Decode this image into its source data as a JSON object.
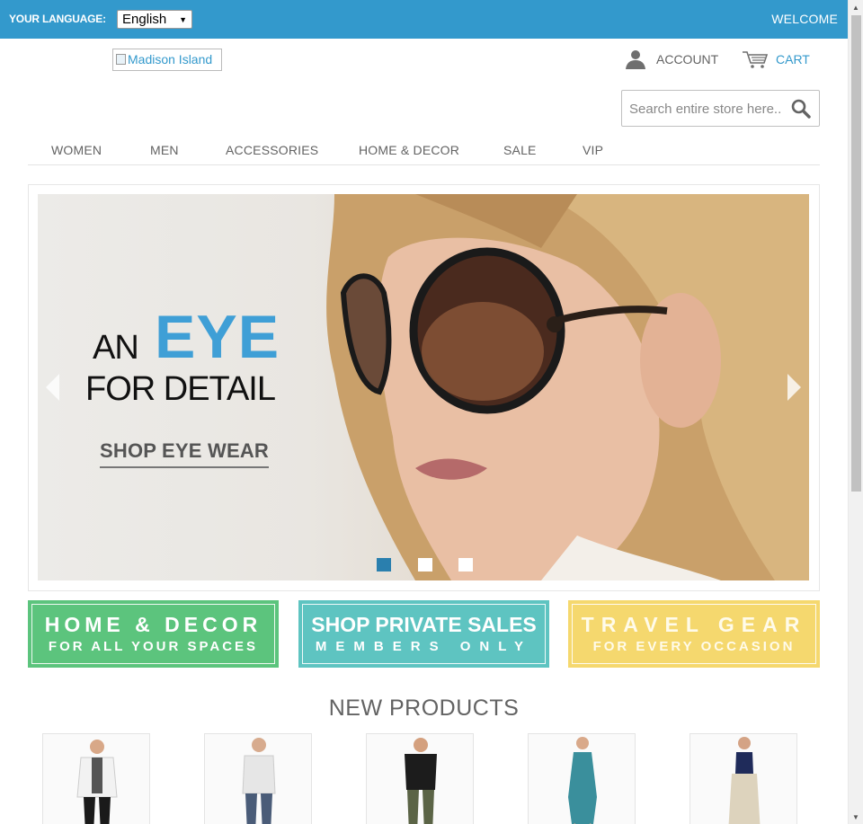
{
  "topbar": {
    "language_label": "YOUR LANGUAGE:",
    "language_value": "English",
    "welcome": "WELCOME",
    "color": "#3399cc"
  },
  "header": {
    "logo_alt": "Madison Island",
    "account_label": "ACCOUNT",
    "cart_label": "CART",
    "search_placeholder": "Search entire store here..."
  },
  "nav": {
    "items": [
      "WOMEN",
      "MEN",
      "ACCESSORIES",
      "HOME & DECOR",
      "SALE",
      "VIP"
    ]
  },
  "slider": {
    "headline_an": "AN",
    "headline_eye": "EYE",
    "headline_detail": "FOR DETAIL",
    "cta": "SHOP EYE WEAR",
    "slide_count": 3,
    "active_slide": 1
  },
  "promos": [
    {
      "line1": "HOME & DECOR",
      "line2": "FOR ALL YOUR SPACES",
      "color": "#5cc47d"
    },
    {
      "line1": "SHOP PRIVATE SALES",
      "line2": "MEMBERS ONLY",
      "color": "#5ec4c1"
    },
    {
      "line1": "TRAVEL GEAR",
      "line2": "FOR EVERY OCCASION",
      "color": "#f5d86e"
    }
  ],
  "new_products": {
    "title": "NEW PRODUCTS",
    "items": [
      "product-1",
      "product-2",
      "product-3",
      "product-4",
      "product-5"
    ]
  },
  "icons": {
    "account": "person-icon",
    "cart": "cart-icon",
    "search": "magnifier-icon",
    "prev": "chevron-left-icon",
    "next": "chevron-right-icon"
  }
}
